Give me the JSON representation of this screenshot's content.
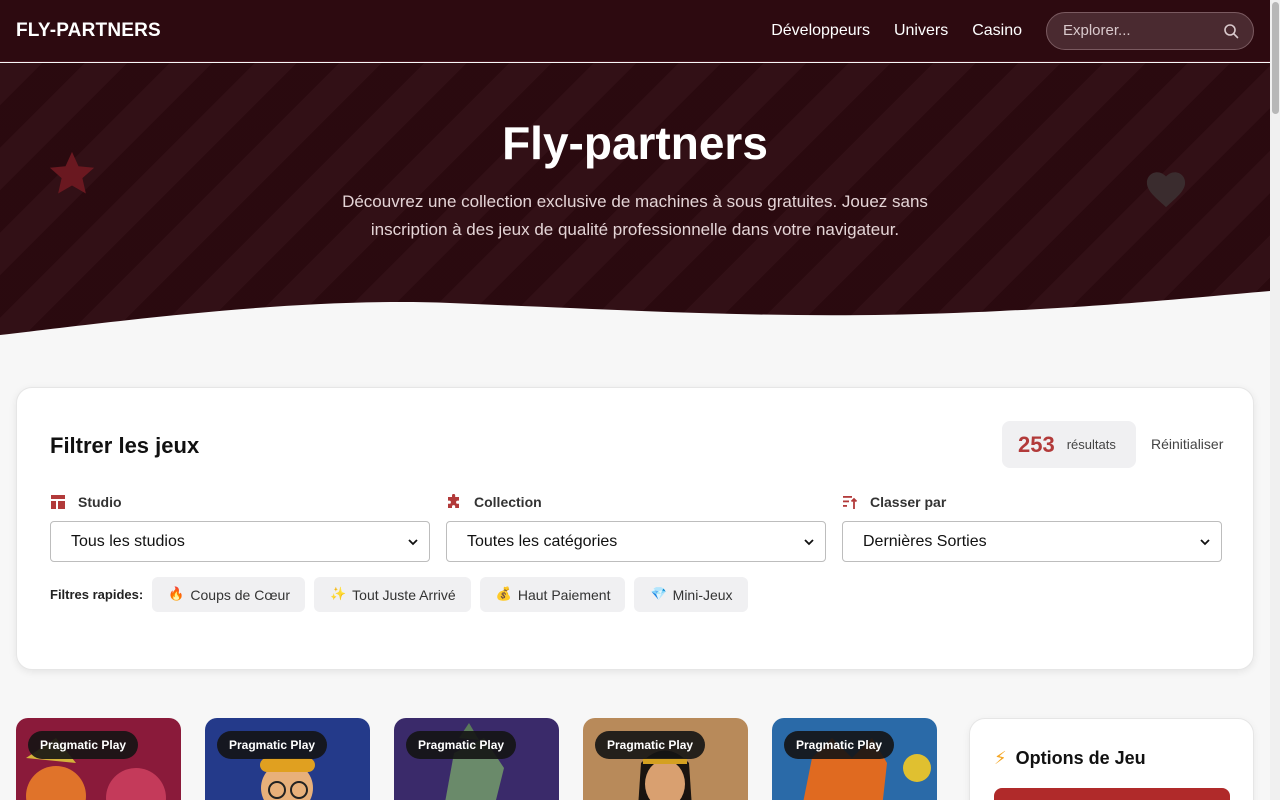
{
  "header": {
    "logo": "FLY-PARTNERS",
    "nav": [
      "Développeurs",
      "Univers",
      "Casino"
    ],
    "search_placeholder": "Explorer..."
  },
  "hero": {
    "title": "Fly-partners",
    "subtitle": "Découvrez une collection exclusive de machines à sous gratuites. Jouez sans inscription à des jeux de qualité professionnelle dans votre navigateur."
  },
  "filters": {
    "title": "Filtrer les jeux",
    "result_count": "253",
    "result_label": "résultats",
    "reset_label": "Réinitialiser",
    "studio": {
      "label": "Studio",
      "selected": "Tous les studios"
    },
    "collection": {
      "label": "Collection",
      "selected": "Toutes les catégories"
    },
    "sort": {
      "label": "Classer par",
      "selected": "Dernières Sorties"
    },
    "quick_label": "Filtres rapides:",
    "quick_chips": [
      {
        "emoji": "🔥",
        "label": "Coups de Cœur"
      },
      {
        "emoji": "✨",
        "label": "Tout Juste Arrivé"
      },
      {
        "emoji": "💰",
        "label": "Haut Paiement"
      },
      {
        "emoji": "💎",
        "label": "Mini-Jeux"
      }
    ]
  },
  "games": [
    {
      "provider": "Pragmatic Play"
    },
    {
      "provider": "Pragmatic Play"
    },
    {
      "provider": "Pragmatic Play"
    },
    {
      "provider": "Pragmatic Play"
    },
    {
      "provider": "Pragmatic Play"
    }
  ],
  "options": {
    "icon": "⚡",
    "title": "Options de Jeu"
  },
  "colors": {
    "header_bg": "#2d0a10",
    "accent": "#b23a3a",
    "page_bg": "#f7f7f7"
  }
}
